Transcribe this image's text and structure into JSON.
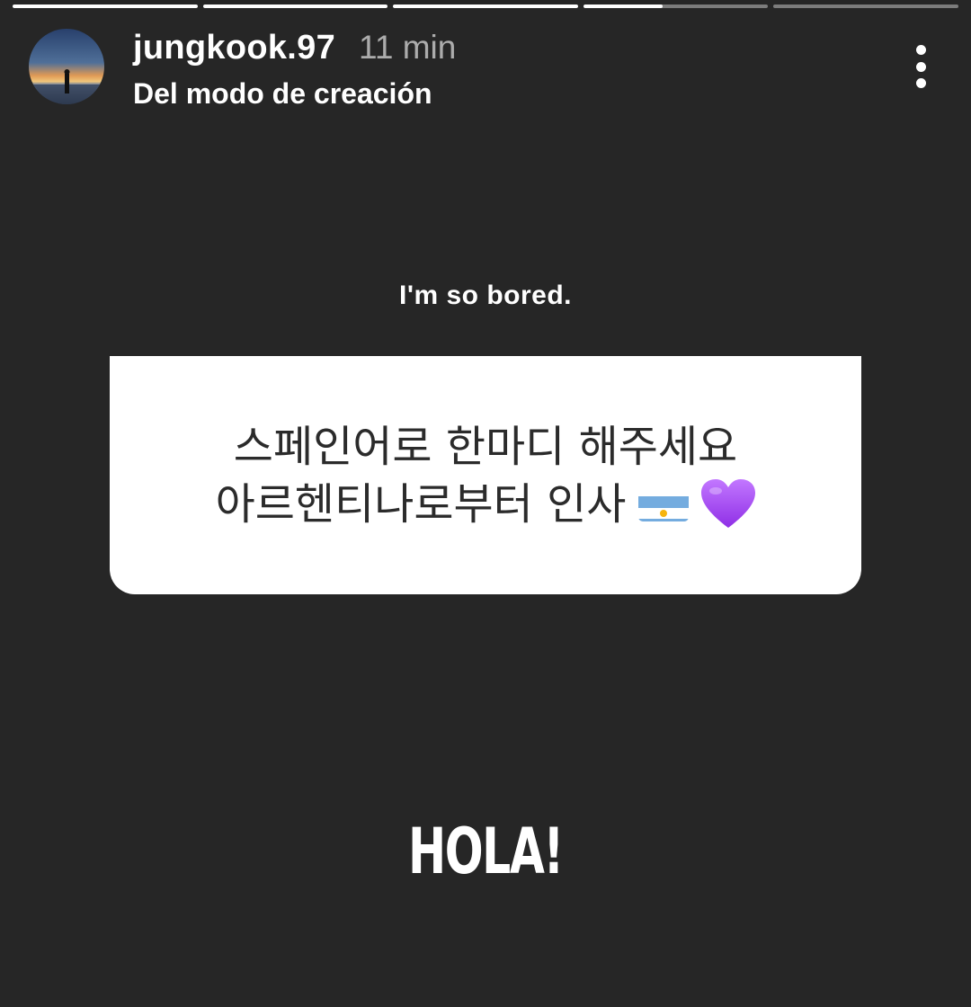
{
  "story": {
    "segments": [
      {
        "fill": 1.0
      },
      {
        "fill": 1.0
      },
      {
        "fill": 1.0
      },
      {
        "fill": 0.43
      },
      {
        "fill": 0.0
      }
    ]
  },
  "header": {
    "username": "jungkook.97",
    "time_ago": "11 min",
    "subtitle": "Del modo de creación",
    "avatar_icon": "sunset-silhouette-avatar",
    "more_icon": "more-vertical-icon"
  },
  "question_sticker": {
    "prompt": "I'm so bored.",
    "line1": "스페인어로 한마디 해주세요",
    "line2": "아르헨티나로부터 인사",
    "emoji": [
      "argentina-flag-icon",
      "purple-heart-icon"
    ],
    "heart_color": "#a855f7",
    "flag_colors": [
      "#74acdf",
      "#ffffff",
      "#f6b40e"
    ]
  },
  "answer": {
    "text": "HOLA!"
  }
}
